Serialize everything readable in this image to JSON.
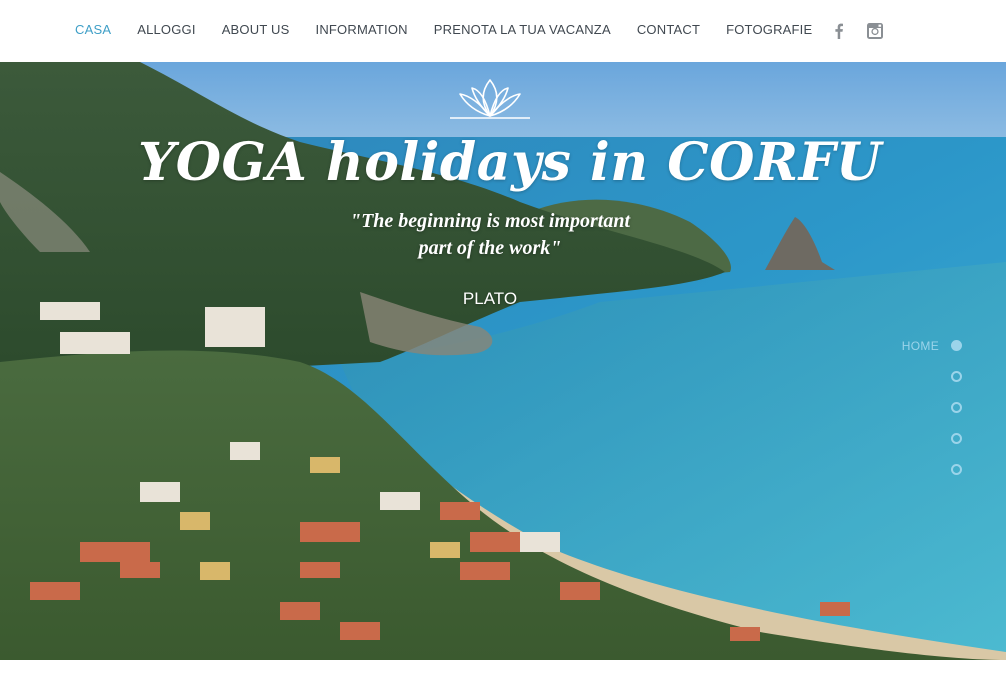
{
  "nav": {
    "items": [
      {
        "label": "CASA",
        "active": true
      },
      {
        "label": "ALLOGGI",
        "active": false
      },
      {
        "label": "ABOUT US",
        "active": false
      },
      {
        "label": "INFORMATION",
        "active": false
      },
      {
        "label": "PRENOTA LA TUA VACANZA",
        "active": false
      },
      {
        "label": "CONTACT",
        "active": false
      },
      {
        "label": "FOTOGRAFIE",
        "active": false
      }
    ],
    "social": [
      {
        "icon": "facebook-icon"
      },
      {
        "icon": "instagram-icon"
      }
    ]
  },
  "hero": {
    "title": "YOGA holidays in CORFU",
    "quote": "\"The beginning is most important part of the work\"",
    "author": "PLATO",
    "logo_icon": "lotus-icon"
  },
  "anchors": {
    "items": [
      {
        "label": "HOME",
        "active": true
      },
      {
        "label": "",
        "active": false
      },
      {
        "label": "",
        "active": false
      },
      {
        "label": "",
        "active": false
      },
      {
        "label": "",
        "active": false
      }
    ]
  },
  "colors": {
    "accent": "#3f9fc7",
    "nav_text": "#404850",
    "anchor": "#9bd4ea"
  }
}
